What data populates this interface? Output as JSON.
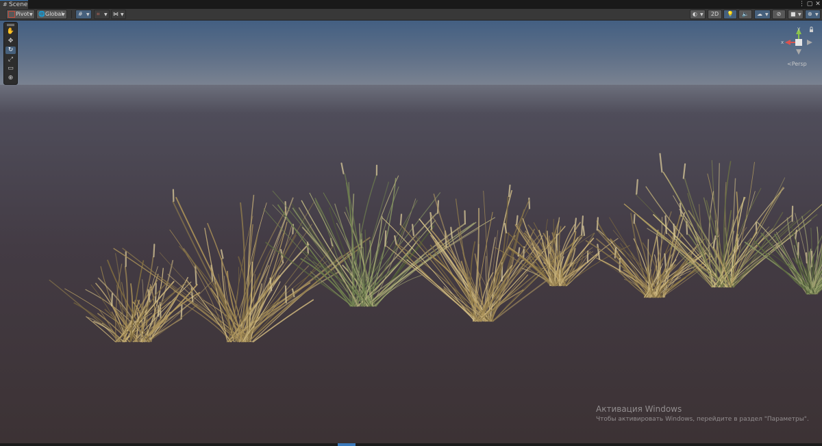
{
  "tab": {
    "label": "Scene",
    "icon": "scene-grid-icon"
  },
  "window_controls": {
    "more": "⋮",
    "maximize": "▢",
    "close": "✕"
  },
  "toolbar": {
    "pivot_label": "Pivot",
    "global_label": "Global",
    "toggle_2d": "2D",
    "icons": [
      "pivot-icon",
      "global-icon",
      "grid-snap-icon",
      "increment-snap-icon",
      "toolbar-overlay-icon",
      "shading-mode-icon",
      "lighting-icon",
      "audio-icon",
      "effects-icon",
      "hidden-objects-icon",
      "camera-icon",
      "gizmos-icon"
    ]
  },
  "tools": {
    "items": [
      {
        "name": "hand-tool",
        "glyph": "✋",
        "active": false
      },
      {
        "name": "move-tool",
        "glyph": "✥",
        "active": false
      },
      {
        "name": "rotate-tool",
        "glyph": "↻",
        "active": true
      },
      {
        "name": "scale-tool",
        "glyph": "⤢",
        "active": false
      },
      {
        "name": "rect-tool",
        "glyph": "▭",
        "active": false
      },
      {
        "name": "transform-tool",
        "glyph": "⊕",
        "active": false
      }
    ]
  },
  "gizmo": {
    "x_label": "x",
    "y_label": "y",
    "persp_label": "Persp",
    "lock_icon": "lock-icon"
  },
  "watermark": {
    "title": "Активация Windows",
    "subtitle": "Чтобы активировать Windows, перейдите в раздел \"Параметры\"."
  },
  "colors": {
    "accent": "#3a79bb",
    "sky_top": "#4a6789",
    "horizon": "#7b8593",
    "ground": "#3f3538"
  }
}
